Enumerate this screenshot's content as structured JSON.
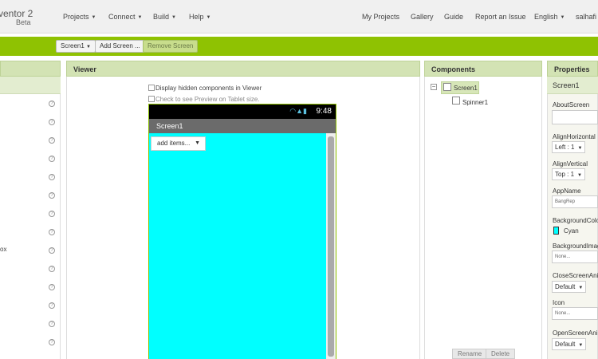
{
  "app": {
    "title": "ventor 2",
    "subtitle": "Beta"
  },
  "topnav": {
    "menus": [
      "Projects",
      "Connect",
      "Build",
      "Help"
    ],
    "links": [
      "My Projects",
      "Gallery",
      "Guide",
      "Report an Issue",
      "English",
      "salhafi"
    ]
  },
  "toolbar": {
    "screen_select": "Screen1",
    "add_screen": "Add Screen ...",
    "remove_screen": "Remove Screen"
  },
  "palette": {
    "partial_label": "ox"
  },
  "viewer": {
    "header": "Viewer",
    "checkbox_hidden": "Display hidden components in Viewer",
    "checkbox_tablet": "Check to see Preview on Tablet size.",
    "phone": {
      "time": "9:48",
      "screen_title": "Screen1",
      "spinner_text": "add items..."
    }
  },
  "components": {
    "header": "Components",
    "tree": [
      {
        "label": "Screen1"
      },
      {
        "label": "Spinner1"
      }
    ],
    "rename": "Rename",
    "delete": "Delete"
  },
  "properties": {
    "header": "Properties",
    "component": "Screen1",
    "about_screen": "AboutScreen",
    "align_horizontal": "AlignHorizontal",
    "align_horizontal_value": "Left : 1",
    "align_vertical": "AlignVertical",
    "align_vertical_value": "Top : 1",
    "app_name": "AppName",
    "app_name_value": "BangRep",
    "background_color": "BackgroundColor",
    "background_color_value": "Cyan",
    "background_image": "BackgroundImage",
    "background_image_value": "None...",
    "close_screen_animation": "CloseScreenAnimation",
    "close_screen_animation_value": "Default",
    "icon": "Icon",
    "icon_value": "None...",
    "open_screen_animation": "OpenScreenAnimation",
    "open_screen_animation_value": "Default"
  },
  "colors": {
    "accent": "#8fc202",
    "header_bg": "#d3e3b4",
    "screen_bg": "#00ffff"
  }
}
